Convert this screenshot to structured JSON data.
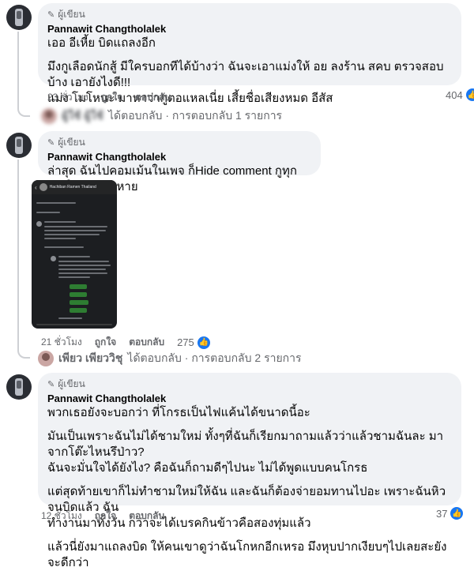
{
  "comments": [
    {
      "badge": "ผู้เขียน",
      "author": "Pannawit Changtholalek",
      "paragraphs": [
        [
          "เออ อีเหี้ย บิดแถลงอีก"
        ],
        [
          "มึงกูเลือดนักสู้ มีใครบอกทีได้บ้างว่า ฉันจะเอาแม่งให้ อย ลงร้าน สคบ ตรวจสอบบ้าง เอายังไงดี!!!",
          "แม่ง โมโหนะ มาหาว่ากูตอแหลเนี่ย เสี้ยชื่อเสียงหมด อีสัส"
        ]
      ],
      "time": "23 ชั่วโมง",
      "like": "ถูกใจ",
      "reply": "ตอบกลับ",
      "reaction_count": "404",
      "replies_summary": {
        "name": "ผู้ใช้ ผู้ใช้",
        "text": "ได้ตอบกลับ · การตอบกลับ 1 รายการ"
      }
    },
    {
      "badge": "ผู้เขียน",
      "author": "Pannawit Changtholalek",
      "paragraphs": [
        [
          "ล่าสุด ฉันไปคอมเม้นในเพจ ก็Hide comment กูทุกอัน ใจหมาขิบหาย"
        ]
      ],
      "image_page_name": "Hachiban Ramen Thailand",
      "time": "21 ชั่วโมง",
      "like": "ถูกใจ",
      "reply": "ตอบกลับ",
      "reaction_count": "275",
      "replies_summary": {
        "name": "เพียว เพียววิชุ",
        "text": "ได้ตอบกลับ · การตอบกลับ 2 รายการ"
      }
    },
    {
      "badge": "ผู้เขียน",
      "author": "Pannawit Changtholalek",
      "paragraphs": [
        [
          "พวกเธอยังจะบอกว่า ที่โกรธเป็นไฟแค้นได้ขนาดนี้อะ"
        ],
        [
          "มันเป็นเพราะฉันไม่ได้ชามใหม่ ทั้งๆที่ฉันก็เรียกมาถามแล้วว่าแล้วชามฉันละ มาจากโต๊ะไหนรึป่าว?",
          "ฉันจะมั่นใจได้ยังไง? คือฉันก็ถามดีๆไปนะ ไม่ได้พูดแบบคนโกรธ"
        ],
        [
          "แต่สุดท้ายเขาก็ไม่ทำชามใหม่ให้ฉัน และฉันก็ต้องจ่ายอมทานไปอะ เพราะฉันหิวจนบิดแล้ว ฉัน",
          "ทำงานมาทั้งวัน กว่าจะได้เบรคกินข้าวคือสองทุ่มแล้ว"
        ],
        [
          "แล้วนี่ยังมาแถลงบิด ให้คนเขาดูว่าฉันโกหกอีกเหรอ มึงหุบปากเงียบๆไปเลยสะยังจะดีกว่า"
        ]
      ],
      "time": "12 ชั่วโมง",
      "like": "ถูกใจ",
      "reply": "ตอบกลับ",
      "reaction_count": "37"
    }
  ],
  "colors": {
    "accent": "#1877f2",
    "bubble": "#f0f2f5",
    "meta": "#65676b"
  },
  "icons": [
    "avatar",
    "pencil-icon",
    "like-reaction-icon"
  ]
}
